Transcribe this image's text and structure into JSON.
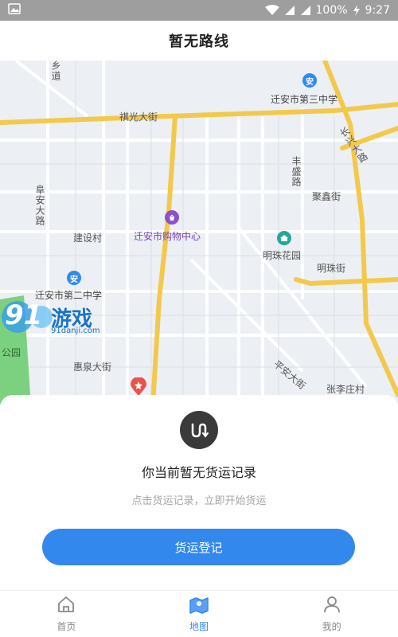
{
  "status_bar": {
    "battery": "100%",
    "time": "9:27",
    "icons": [
      "image-icon",
      "wifi-icon",
      "signal-icon",
      "signal-icon",
      "charging-icon"
    ]
  },
  "header": {
    "title": "暂无路线"
  },
  "map": {
    "roads": {
      "qiguang": "祺光大街",
      "fuan": "阜安大路",
      "fusheng": "丰盛路",
      "changxing": "长兴大路",
      "ju_xin": "聚鑫街",
      "mingzhu": "明珠街",
      "huiquan": "惠泉大街",
      "pingan": "平安大街",
      "xiangdao": "乡道"
    },
    "places": {
      "third_school": "迁安市第三中学",
      "second_school": "迁安市第二中学",
      "mall": "迁安市购物中心",
      "garden": "明珠花园",
      "jianshe": "建设村",
      "zhangli": "张李庄村",
      "park": "公园"
    },
    "pin_school": "安",
    "colors": {
      "road_major": "#f2c94c",
      "road_minor": "#ffffff",
      "background": "#eceff3",
      "park": "#7bd17f"
    }
  },
  "watermark": {
    "brand": "游戏",
    "digits": "91",
    "url": "91danji.com"
  },
  "empty_state": {
    "icon": "route-icon",
    "title": "你当前暂无货运记录",
    "subtitle": "点击货运记录，立即开始货运",
    "button_label": "货运登记",
    "accent": "#3388ee"
  },
  "tabs": [
    {
      "label": "首页",
      "icon": "home-icon",
      "active": false
    },
    {
      "label": "地图",
      "icon": "map-icon",
      "active": true
    },
    {
      "label": "我的",
      "icon": "user-icon",
      "active": false
    }
  ]
}
